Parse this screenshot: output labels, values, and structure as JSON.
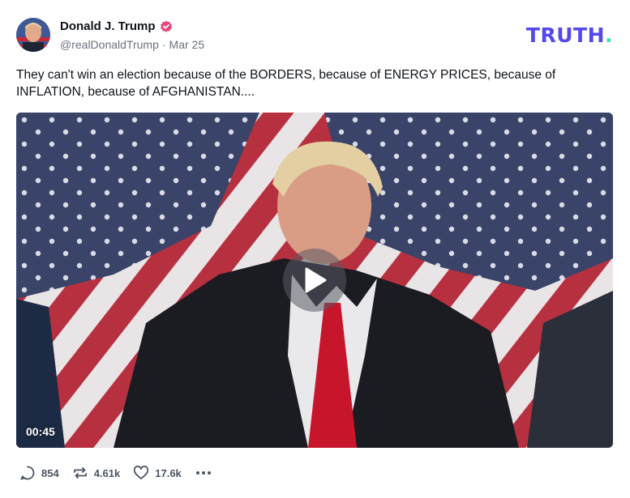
{
  "author": {
    "name": "Donald J. Trump",
    "handle": "@realDonaldTrump",
    "separator": "·",
    "date": "Mar 25",
    "verified": true
  },
  "brand": {
    "logo_text": "TRUTH",
    "logo_dot": ".",
    "primary_color": "#5448ee",
    "dot_color": "#3ee0c0"
  },
  "post": {
    "text": "They can't win an election because of the BORDERS, because of ENERGY PRICES, because of INFLATION, because of AFGHANISTAN...."
  },
  "video": {
    "duration": "00:45"
  },
  "actions": {
    "replies": "854",
    "retruths": "4.61k",
    "likes": "17.6k"
  },
  "icons": [
    "verified-badge-icon",
    "reply-icon",
    "retruth-icon",
    "like-icon",
    "more-icon",
    "play-icon"
  ]
}
